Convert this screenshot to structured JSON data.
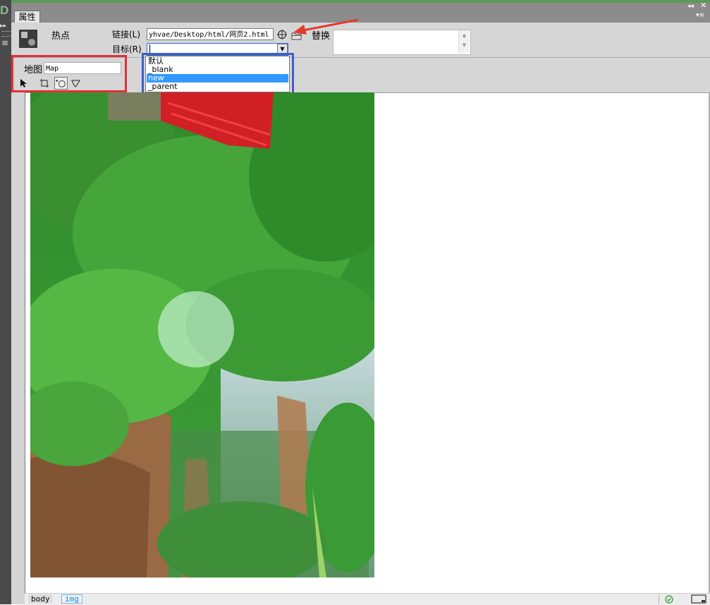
{
  "app": {
    "logo_letter": "D"
  },
  "panel": {
    "tab_label": "属性"
  },
  "window_controls": {
    "collapse": "◂◂",
    "close": "✕",
    "menu": "▾≡",
    "left_collapse": "▸▸"
  },
  "hotspot": {
    "label": "热点",
    "link_label": "链接(L)",
    "link_value": "yhvae/Desktop/html/网页2.html",
    "target_label": "目标(R)",
    "target_value": "",
    "target_options": [
      "默认",
      "_blank",
      "new",
      "_parent"
    ],
    "target_selected_option": "new",
    "alt_label": "替换",
    "alt_value": ""
  },
  "map": {
    "label": "地图",
    "name_value": "Map",
    "tools": [
      "pointer-hotspot-tool",
      "rectangle-hotspot-tool",
      "circle-hotspot-tool",
      "polygon-hotspot-tool"
    ]
  },
  "status_bar": {
    "tags": [
      "body",
      "img"
    ]
  },
  "colors": {
    "red_highlight": "#e0303a",
    "blue_highlight": "#3f5fcc",
    "selection": "#3399ff",
    "tab_bar": "#8c8c8c",
    "panel_bg": "#d6d6d6"
  }
}
